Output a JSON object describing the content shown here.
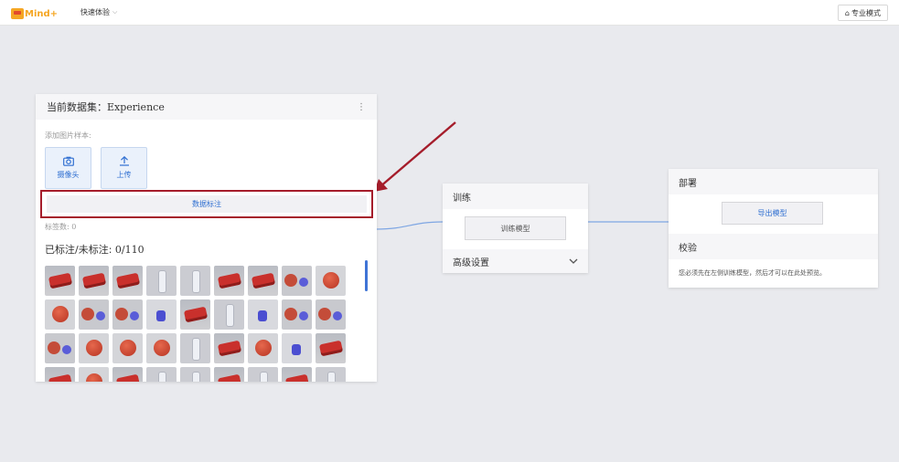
{
  "topbar": {
    "logo_text": "Mind+",
    "menu_label": "快速体验",
    "pro_mode_label": "专业模式"
  },
  "dataset": {
    "title": "当前数据集：Experience",
    "add_samples_label": "添加图片样本:",
    "camera_label": "摄像头",
    "upload_label": "上传",
    "annotate_label": "数据标注",
    "tag_count_label": "标签数:",
    "tag_count_value": "0",
    "labeled_label": "已标注/未标注:",
    "labeled_value": "0/110",
    "thumbnails": [
      "can",
      "can",
      "can",
      "bottle",
      "bottle",
      "can",
      "can",
      "mix",
      "apple",
      "apple",
      "mix",
      "mix",
      "blue",
      "can",
      "bottle",
      "blue",
      "mix",
      "mix",
      "mix",
      "apple",
      "apple",
      "apple",
      "bottle",
      "can",
      "apple",
      "blue",
      "can",
      "can",
      "apple",
      "can",
      "bottle",
      "bottle",
      "can",
      "bottle",
      "can",
      "bottle"
    ]
  },
  "train": {
    "title": "训练",
    "train_button": "训练模型",
    "advanced_label": "高级设置"
  },
  "deploy": {
    "title": "部署",
    "export_button": "导出模型",
    "verify_title": "校验",
    "verify_message": "您必须先在左侧训练模型，然后才可以在此处预览。"
  },
  "colors": {
    "accent_blue": "#2f6fd1",
    "highlight_red": "#a51d2b",
    "connector": "#7ea6e3"
  },
  "icons": {
    "camera": "camera-icon",
    "upload": "upload-icon",
    "more": "more-vertical-icon",
    "lock": "lock-icon",
    "chevron": "chevron-down-icon"
  }
}
